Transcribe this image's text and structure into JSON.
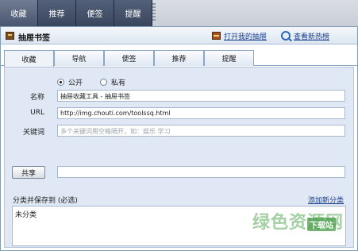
{
  "top_tabs": [
    {
      "label": "收藏",
      "active": true
    },
    {
      "label": "推荐",
      "active": false
    },
    {
      "label": "便签",
      "active": false
    },
    {
      "label": "提醒",
      "active": false
    }
  ],
  "window": {
    "title": "抽屉书签",
    "open_drawer_link": "打开我的抽屉",
    "hot_link": "查看新热榜"
  },
  "sub_tabs": [
    {
      "label": "收藏",
      "active": true
    },
    {
      "label": "导航",
      "active": false
    },
    {
      "label": "便签",
      "active": false
    },
    {
      "label": "推荐",
      "active": false
    },
    {
      "label": "提醒",
      "active": false
    }
  ],
  "form": {
    "privacy_public": "公开",
    "privacy_private": "私有",
    "name_label": "名称",
    "name_value": "抽屉收藏工具 - 抽屉书签",
    "url_label": "URL",
    "url_value": "http://img.chouti.com/toolssq.html",
    "keywords_label": "关键词",
    "keywords_placeholder": "多个关键词用空格隔开，如：娱乐 学习",
    "share_button": "共享",
    "share_value": ""
  },
  "category": {
    "header": "分类并保存到 (必选)",
    "add_link": "添加新分类",
    "items": [
      "未分类"
    ]
  },
  "watermark": {
    "text": "绿色资源网",
    "badge": "下载站"
  }
}
